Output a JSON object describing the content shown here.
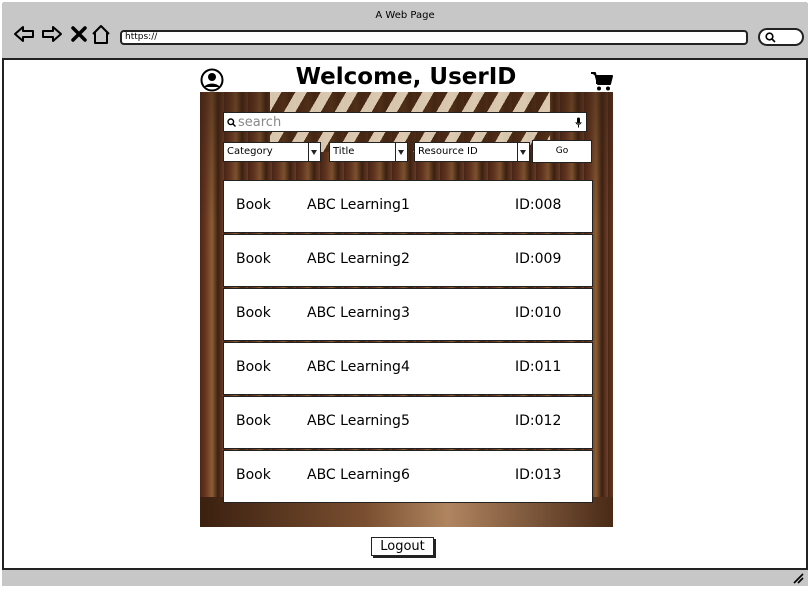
{
  "browser": {
    "window_title": "A Web Page",
    "address": "https://"
  },
  "page": {
    "welcome": "Welcome, UserID",
    "search_placeholder": "search",
    "filters": {
      "category": "Category",
      "title": "Title",
      "resource_id": "Resource ID",
      "go_label": "Go"
    },
    "results": [
      {
        "type": "Book",
        "title": "ABC Learning1",
        "id": "ID:008"
      },
      {
        "type": "Book",
        "title": "ABC Learning2",
        "id": "ID:009"
      },
      {
        "type": "Book",
        "title": "ABC Learning3",
        "id": "ID:010"
      },
      {
        "type": "Book",
        "title": "ABC Learning4",
        "id": "ID:011"
      },
      {
        "type": "Book",
        "title": "ABC Learning5",
        "id": "ID:012"
      },
      {
        "type": "Book",
        "title": "ABC Learning6",
        "id": "ID:013"
      }
    ],
    "logout_label": "Logout"
  },
  "icons": {
    "back": "back-arrow-icon",
    "forward": "forward-arrow-icon",
    "stop": "close-icon",
    "home": "home-icon",
    "browser_search": "search-icon",
    "user": "user-icon",
    "cart": "cart-icon",
    "search": "search-icon",
    "mic": "microphone-icon",
    "resize": "resize-grip-icon"
  }
}
